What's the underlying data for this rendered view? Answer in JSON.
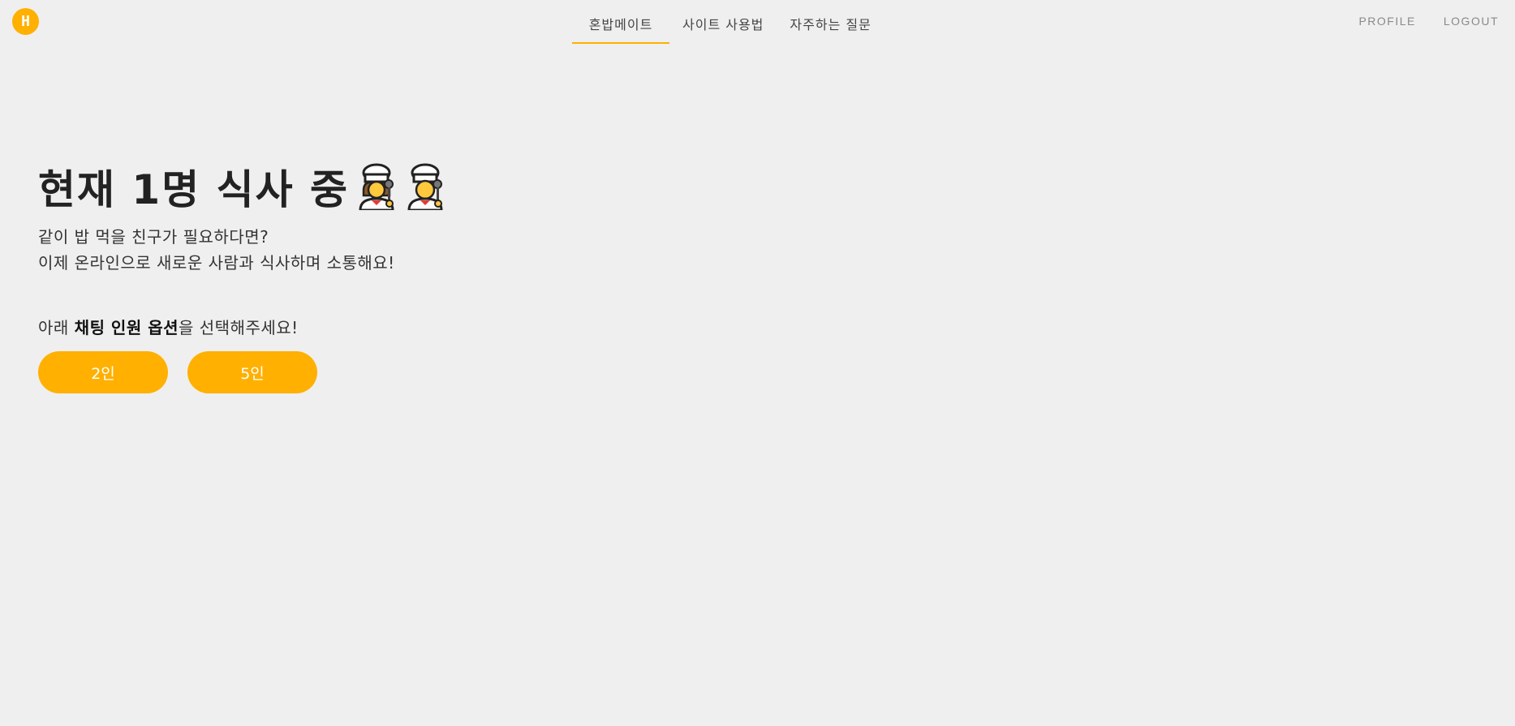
{
  "logo": {
    "letter": "H",
    "color": "#ffb000"
  },
  "nav": {
    "items": [
      {
        "label": "혼밥메이트",
        "active": true
      },
      {
        "label": "사이트 사용법",
        "active": false
      },
      {
        "label": "자주하는 질문",
        "active": false
      }
    ]
  },
  "user": {
    "profile_label": "PROFILE",
    "logout_label": "LOGOUT"
  },
  "hero": {
    "headline": "현재 1명 식사 중",
    "emoji_icons": [
      "woman-cook-icon",
      "man-cook-icon"
    ],
    "description_line1": "같이 밥 먹을 친구가 필요하다면?",
    "description_line2": "이제 온라인으로 새로운 사람과 식사하며 소통해요!",
    "prompt_prefix": "아래 ",
    "prompt_bold": "채팅 인원 옵션",
    "prompt_suffix": "을 선택해주세요!"
  },
  "options": {
    "two_label": "2인",
    "five_label": "5인"
  },
  "colors": {
    "accent": "#ffb000",
    "background": "#efefef"
  }
}
